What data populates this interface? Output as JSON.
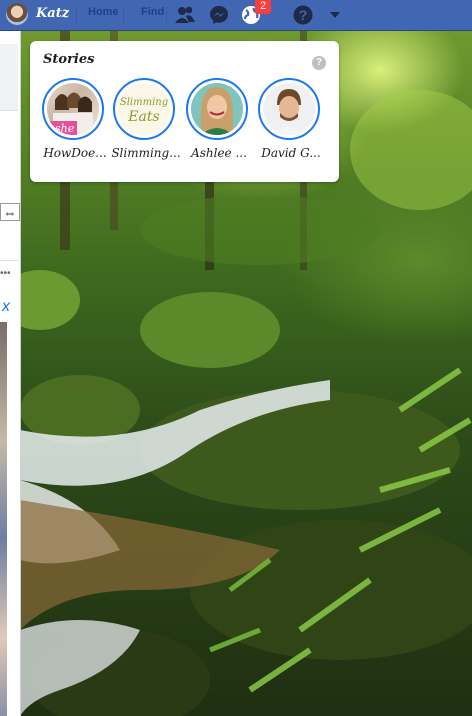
{
  "topbar": {
    "user_name": "Katz",
    "nav_link_1": "Home",
    "nav_link_2": "Find Friends",
    "notifications_count": "2",
    "icons": [
      "friends-icon",
      "messenger-icon",
      "notifications-globe-icon",
      "help-icon",
      "caret-down-icon"
    ],
    "colors": {
      "bar": "#4267b2",
      "badge": "#fa3e3e"
    }
  },
  "left_panel": {
    "resize_glyph": "⇔",
    "dots": "•••",
    "close_glyph": "x"
  },
  "stories": {
    "title": "Stories",
    "help_glyph": "?",
    "items": [
      {
        "label": "HowDoe..."
      },
      {
        "label": "Slimming..."
      },
      {
        "label": "Ashlee ..."
      },
      {
        "label": "David G..."
      }
    ],
    "slimming_logo_line1": "Slimming",
    "slimming_logo_line2": "Eats",
    "howdoes_logo": "she",
    "ring_color": "#1877f2"
  }
}
